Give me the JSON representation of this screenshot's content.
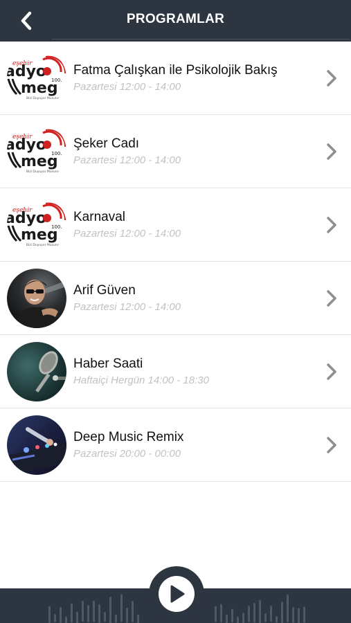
{
  "header": {
    "title": "PROGRAMLAR",
    "back_icon": "chevron-left-icon"
  },
  "programs": [
    {
      "name": "Fatma Çalışkan ile Psikolojik Bakış",
      "schedule": "Pazartesi 12:00 - 14:00",
      "image": "radyo-mega-logo"
    },
    {
      "name": "Şeker Cadı",
      "schedule": "Pazartesi 12:00 - 14:00",
      "image": "radyo-mega-logo"
    },
    {
      "name": "Karnaval",
      "schedule": "Pazartesi 12:00 - 14:00",
      "image": "radyo-mega-logo"
    },
    {
      "name": "Arif Güven",
      "schedule": "Pazartesi 12:00 - 14:00",
      "image": "host-photo"
    },
    {
      "name": "Haber Saati",
      "schedule": "Haftaiçi Hergün 14:00 - 18:30",
      "image": "microphone-photo"
    },
    {
      "name": "Deep Music Remix",
      "schedule": "Pazartesi 20:00 - 00:00",
      "image": "dj-mixer-photo"
    }
  ],
  "logo": {
    "script_text": "eşehir",
    "line1": "adyo",
    "line2": "meg",
    "freq": "100.",
    "tagline": "Bizi Duyuyor Musunuz"
  },
  "player": {
    "play_icon": "play-icon",
    "waveform_icon": "waveform-icon"
  },
  "colors": {
    "header_bg": "#2d3540",
    "accent_red": "#d0201f",
    "text": "#111111",
    "subtext": "#c2c2c2",
    "chevron": "#8e8e93",
    "divider": "#e4e4e4"
  }
}
